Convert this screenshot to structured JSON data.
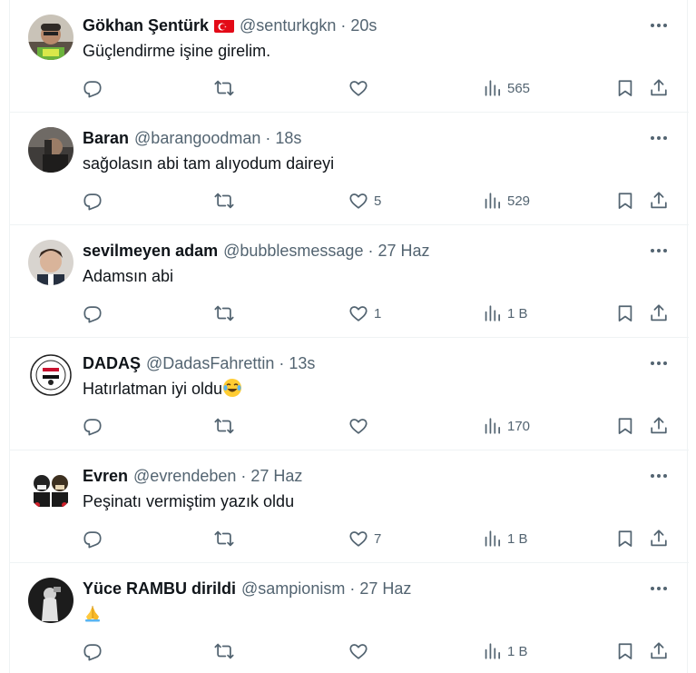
{
  "tweets": [
    {
      "name": "Gökhan Şentürk",
      "flag": true,
      "handle": "@senturkgkn",
      "time": "20s",
      "text": "Güçlendirme işine girelim.",
      "likes": "",
      "views": "565",
      "emoji": ""
    },
    {
      "name": "Baran",
      "flag": false,
      "handle": "@barangoodman",
      "time": "18s",
      "text": "sağolasın abi tam alıyodum daireyi",
      "likes": "5",
      "views": "529",
      "emoji": ""
    },
    {
      "name": "sevilmeyen adam",
      "flag": false,
      "handle": "@bubblesmessage",
      "time": "27 Haz",
      "text": "Adamsın abi",
      "likes": "1",
      "views": "1 B",
      "emoji": ""
    },
    {
      "name": "DADAŞ",
      "flag": false,
      "handle": "@DadasFahrettin",
      "time": "13s",
      "text": "Hatırlatman iyi oldu",
      "likes": "",
      "views": "170",
      "emoji": "laughing-tears-emoji"
    },
    {
      "name": "Evren",
      "flag": false,
      "handle": "@evrendeben",
      "time": "27 Haz",
      "text": "Peşinatı vermiştim yazık oldu",
      "likes": "7",
      "views": "1 B",
      "emoji": ""
    },
    {
      "name": "Yüce RAMBU dirildi",
      "flag": false,
      "handle": "@sampionism",
      "time": "27 Haz",
      "text": "",
      "likes": "",
      "views": "1 B",
      "emoji": "folded-hands-emoji"
    }
  ],
  "icons": {
    "reply": "reply-icon",
    "retweet": "retweet-icon",
    "like": "heart-icon",
    "views": "views-chart-icon",
    "bookmark": "bookmark-icon",
    "share": "share-icon",
    "more": "more-dots-icon"
  },
  "colors": {
    "text": "#0f1419",
    "secondary": "#536471",
    "border": "#eff3f4",
    "flag_red": "#e30a17"
  }
}
